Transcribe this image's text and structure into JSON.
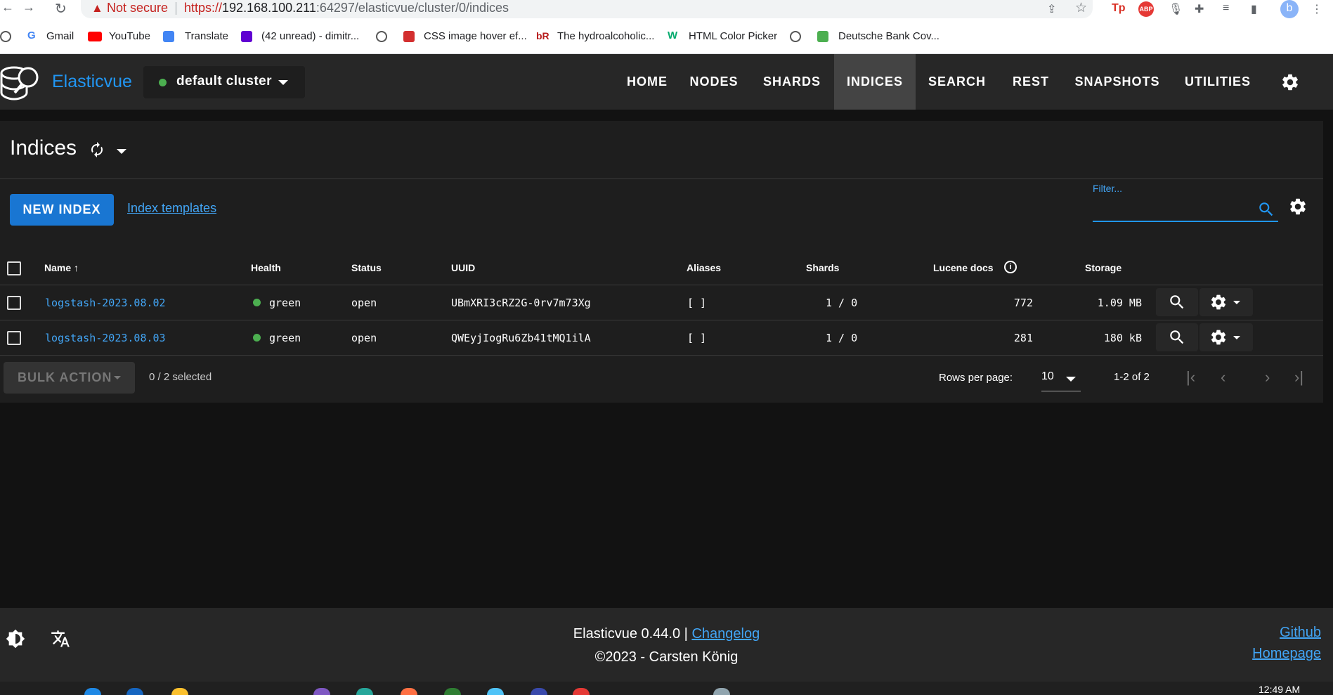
{
  "browser": {
    "security_label": "Not secure",
    "url_protocol": "https://",
    "url_host": "192.168.100.211",
    "url_rest": ":64297/elasticvue/cluster/0/indices",
    "profile_initial": "b"
  },
  "bookmarks": [
    {
      "label": "Gmail",
      "icon": "google-icon",
      "color": "#4285f4"
    },
    {
      "label": "YouTube",
      "icon": "youtube-icon",
      "color": "#ff0000"
    },
    {
      "label": "Translate",
      "icon": "translate-icon",
      "color": "#4285f4"
    },
    {
      "label": "(42 unread) - dimitr...",
      "icon": "mail-icon",
      "color": "#6001d2"
    },
    {
      "label": "CSS image hover ef...",
      "icon": "css-icon",
      "color": "#d32f2f"
    },
    {
      "label": "The hydroalcoholic...",
      "icon": "br-icon",
      "color": "#b71c1c"
    },
    {
      "label": "HTML Color Picker",
      "icon": "w3-icon",
      "color": "#04aa6d"
    },
    {
      "label": "Deutsche Bank Cov...",
      "icon": "bank-icon",
      "color": "#4caf50"
    }
  ],
  "app": {
    "brand": "Elasticvue",
    "cluster": "default cluster",
    "nav": [
      "HOME",
      "NODES",
      "SHARDS",
      "INDICES",
      "SEARCH",
      "REST",
      "SNAPSHOTS",
      "UTILITIES"
    ],
    "active_nav": "INDICES"
  },
  "page": {
    "title": "Indices",
    "new_index": "NEW INDEX",
    "templates_link": "Index templates",
    "filter_placeholder": "Filter..."
  },
  "table": {
    "headers": {
      "name": "Name",
      "health": "Health",
      "status": "Status",
      "uuid": "UUID",
      "aliases": "Aliases",
      "shards": "Shards",
      "docs": "Lucene docs",
      "storage": "Storage"
    },
    "rows": [
      {
        "name": "logstash-2023.08.02",
        "health": "green",
        "status": "open",
        "uuid": "UBmXRI3cRZ2G-0rv7m73Xg",
        "aliases": "[ ]",
        "shards": "1 / 0",
        "docs": "772",
        "storage": "1.09 MB"
      },
      {
        "name": "logstash-2023.08.03",
        "health": "green",
        "status": "open",
        "uuid": "QWEyjIogRu6Zb41tMQ1ilA",
        "aliases": "[ ]",
        "shards": "1 / 0",
        "docs": "281",
        "storage": "180 kB"
      }
    ]
  },
  "pagination": {
    "bulk_action": "BULK ACTION",
    "selected": "0 / 2 selected",
    "rows_per_page_label": "Rows per page:",
    "rows_per_page": "10",
    "range": "1-2 of 2"
  },
  "footer": {
    "version": "Elasticvue 0.44.0 |",
    "changelog": "Changelog",
    "copyright": "©2023 - Carsten König",
    "github": "Github",
    "homepage": "Homepage"
  },
  "taskbar": {
    "time": "12:49 AM"
  },
  "colors": {
    "accent": "#2196f3",
    "health_green": "#4caf50",
    "background": "#121212"
  }
}
